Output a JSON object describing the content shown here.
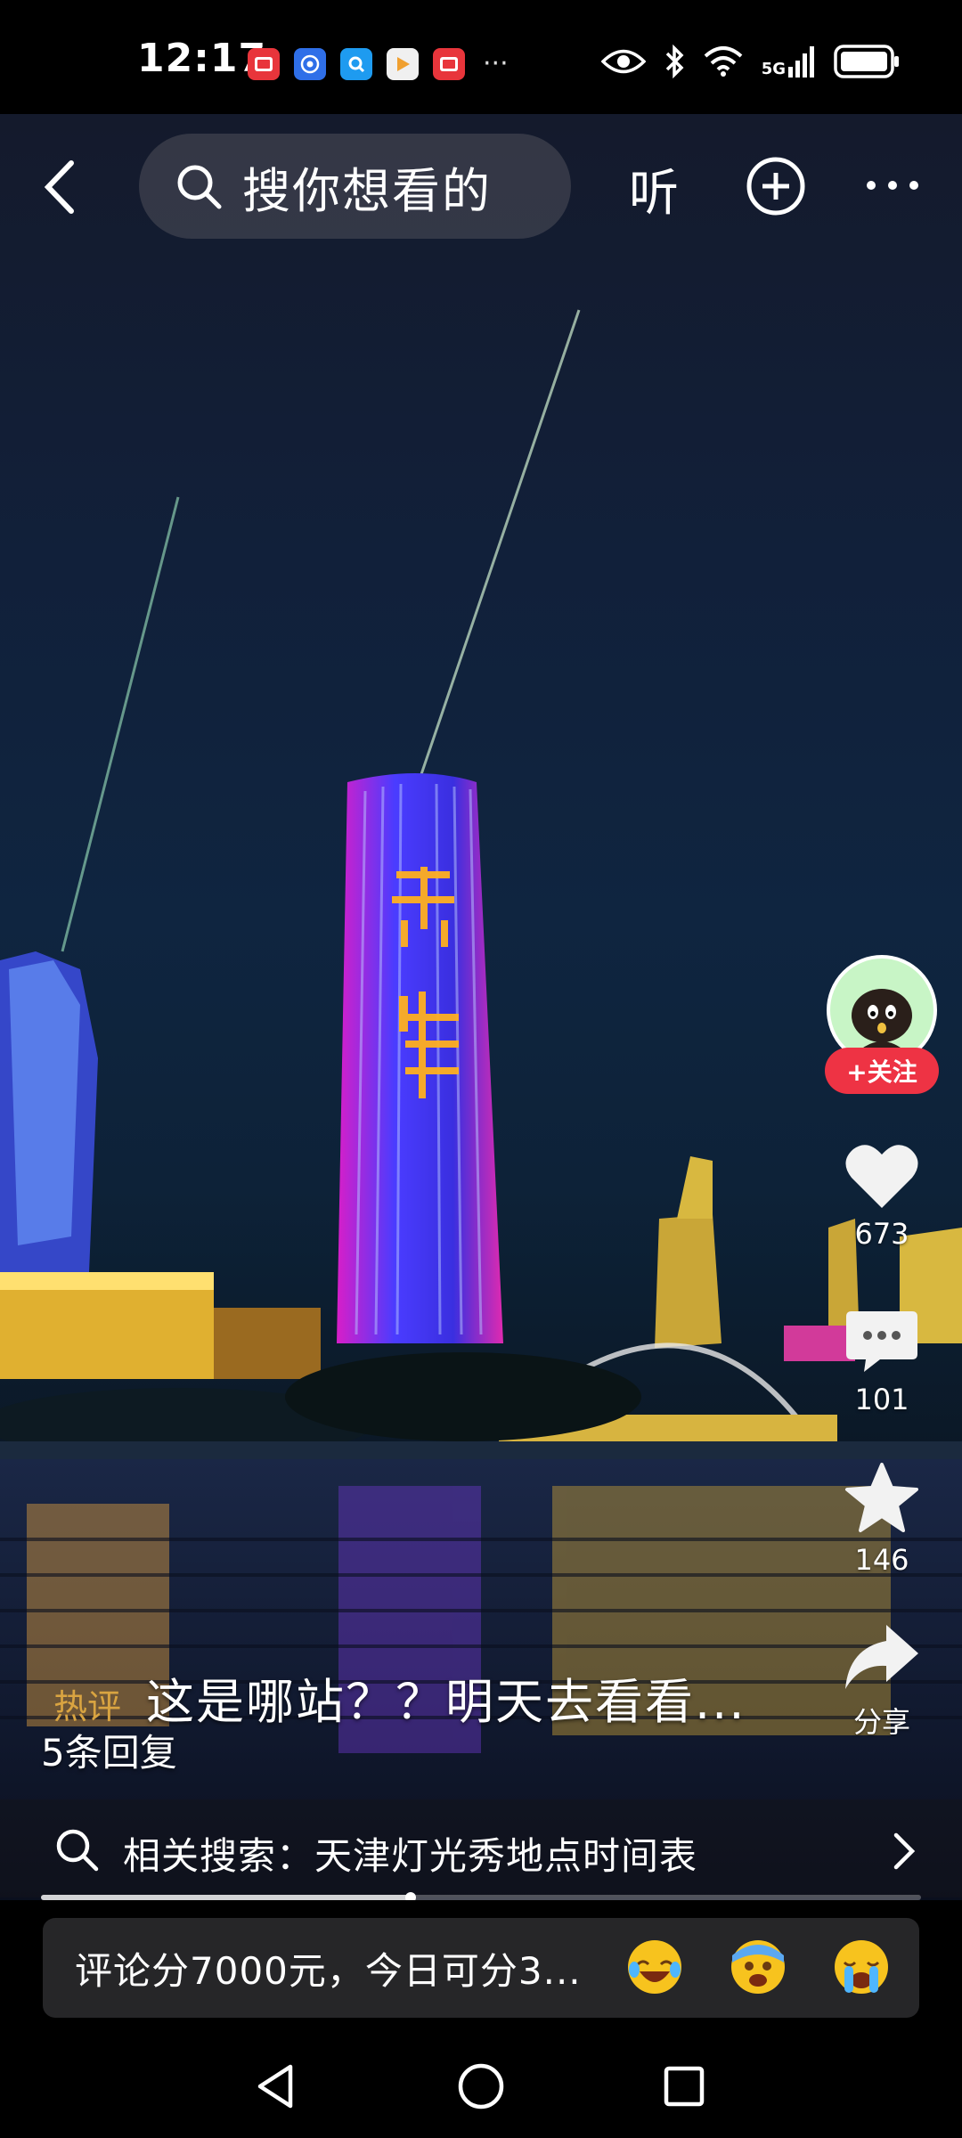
{
  "status_bar": {
    "time": "12:17",
    "notifications": [
      {
        "icon": "red-app-icon",
        "color": "#e8353b"
      },
      {
        "icon": "blue-shield-app-icon",
        "color": "#2f6fe8"
      },
      {
        "icon": "blue-search-app-icon",
        "color": "#1e9bf0"
      },
      {
        "icon": "play-app-icon",
        "color": "#f0a030"
      },
      {
        "icon": "red-app-icon",
        "color": "#e8353b"
      }
    ],
    "network_label": "5G"
  },
  "top_bar": {
    "search_placeholder": "搜你想看的",
    "listen_label": "听"
  },
  "side_actions": {
    "follow_label": "+关注",
    "like_count": "673",
    "comment_count": "101",
    "favorite_count": "146",
    "share_label": "分享"
  },
  "overlay": {
    "hot_tag": "热评",
    "hot_comment": "这是哪站？？明天去看看...",
    "replies": "5条回复",
    "related_search": "相关搜索：天津灯光秀地点时间表",
    "progress": 0.42
  },
  "comment_bar": {
    "placeholder": "评论分7000元，今日可分3...",
    "emojis": [
      "laughing-crying-emoji",
      "anxious-emoji",
      "crying-emoji"
    ]
  },
  "colors": {
    "accent_red": "#ee3344",
    "hot_tag": "#d9a441"
  }
}
